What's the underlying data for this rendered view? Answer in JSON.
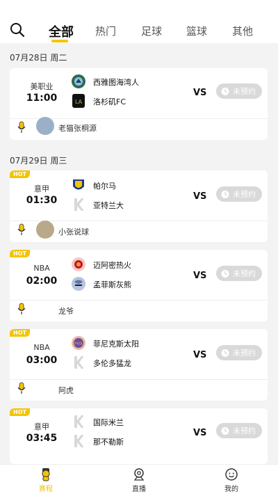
{
  "tabs": [
    {
      "label": "全部",
      "active": true
    },
    {
      "label": "热门",
      "active": false
    },
    {
      "label": "足球",
      "active": false
    },
    {
      "label": "篮球",
      "active": false
    },
    {
      "label": "其他",
      "active": false
    }
  ],
  "dates": [
    "07月28日 周二",
    "07月29日 周三"
  ],
  "matches": [
    {
      "hot": false,
      "league": "美职业",
      "time": "11:00",
      "home": "西雅图海湾人",
      "away": "洛杉矶FC",
      "vs": "VS",
      "reserve": "未预约",
      "anchor": "老猫张桐源"
    },
    {
      "hot": true,
      "hot_label": "HOT",
      "league": "意甲",
      "time": "01:30",
      "home": "帕尔马",
      "away": "亚特兰大",
      "vs": "VS",
      "reserve": "未预约",
      "anchor": "小张说球"
    },
    {
      "hot": true,
      "hot_label": "HOT",
      "league": "NBA",
      "time": "02:00",
      "home": "迈阿密热火",
      "away": "孟菲斯灰熊",
      "vs": "VS",
      "reserve": "未预约",
      "anchor": "龙爷"
    },
    {
      "hot": true,
      "hot_label": "HOT",
      "league": "NBA",
      "time": "03:00",
      "home": "菲尼克斯太阳",
      "away": "多伦多猛龙",
      "vs": "VS",
      "reserve": "未预约",
      "anchor": "阿虎"
    },
    {
      "hot": true,
      "hot_label": "HOT",
      "league": "意甲",
      "time": "03:45",
      "home": "国际米兰",
      "away": "那不勒斯",
      "vs": "VS",
      "reserve": "未预约",
      "anchor": ""
    }
  ],
  "bottom_nav": [
    {
      "label": "赛程",
      "active": true
    },
    {
      "label": "直播",
      "active": false
    },
    {
      "label": "我的",
      "active": false
    }
  ],
  "colors": {
    "accent": "#f5c400",
    "reserve_bg": "#d9d9d9"
  }
}
